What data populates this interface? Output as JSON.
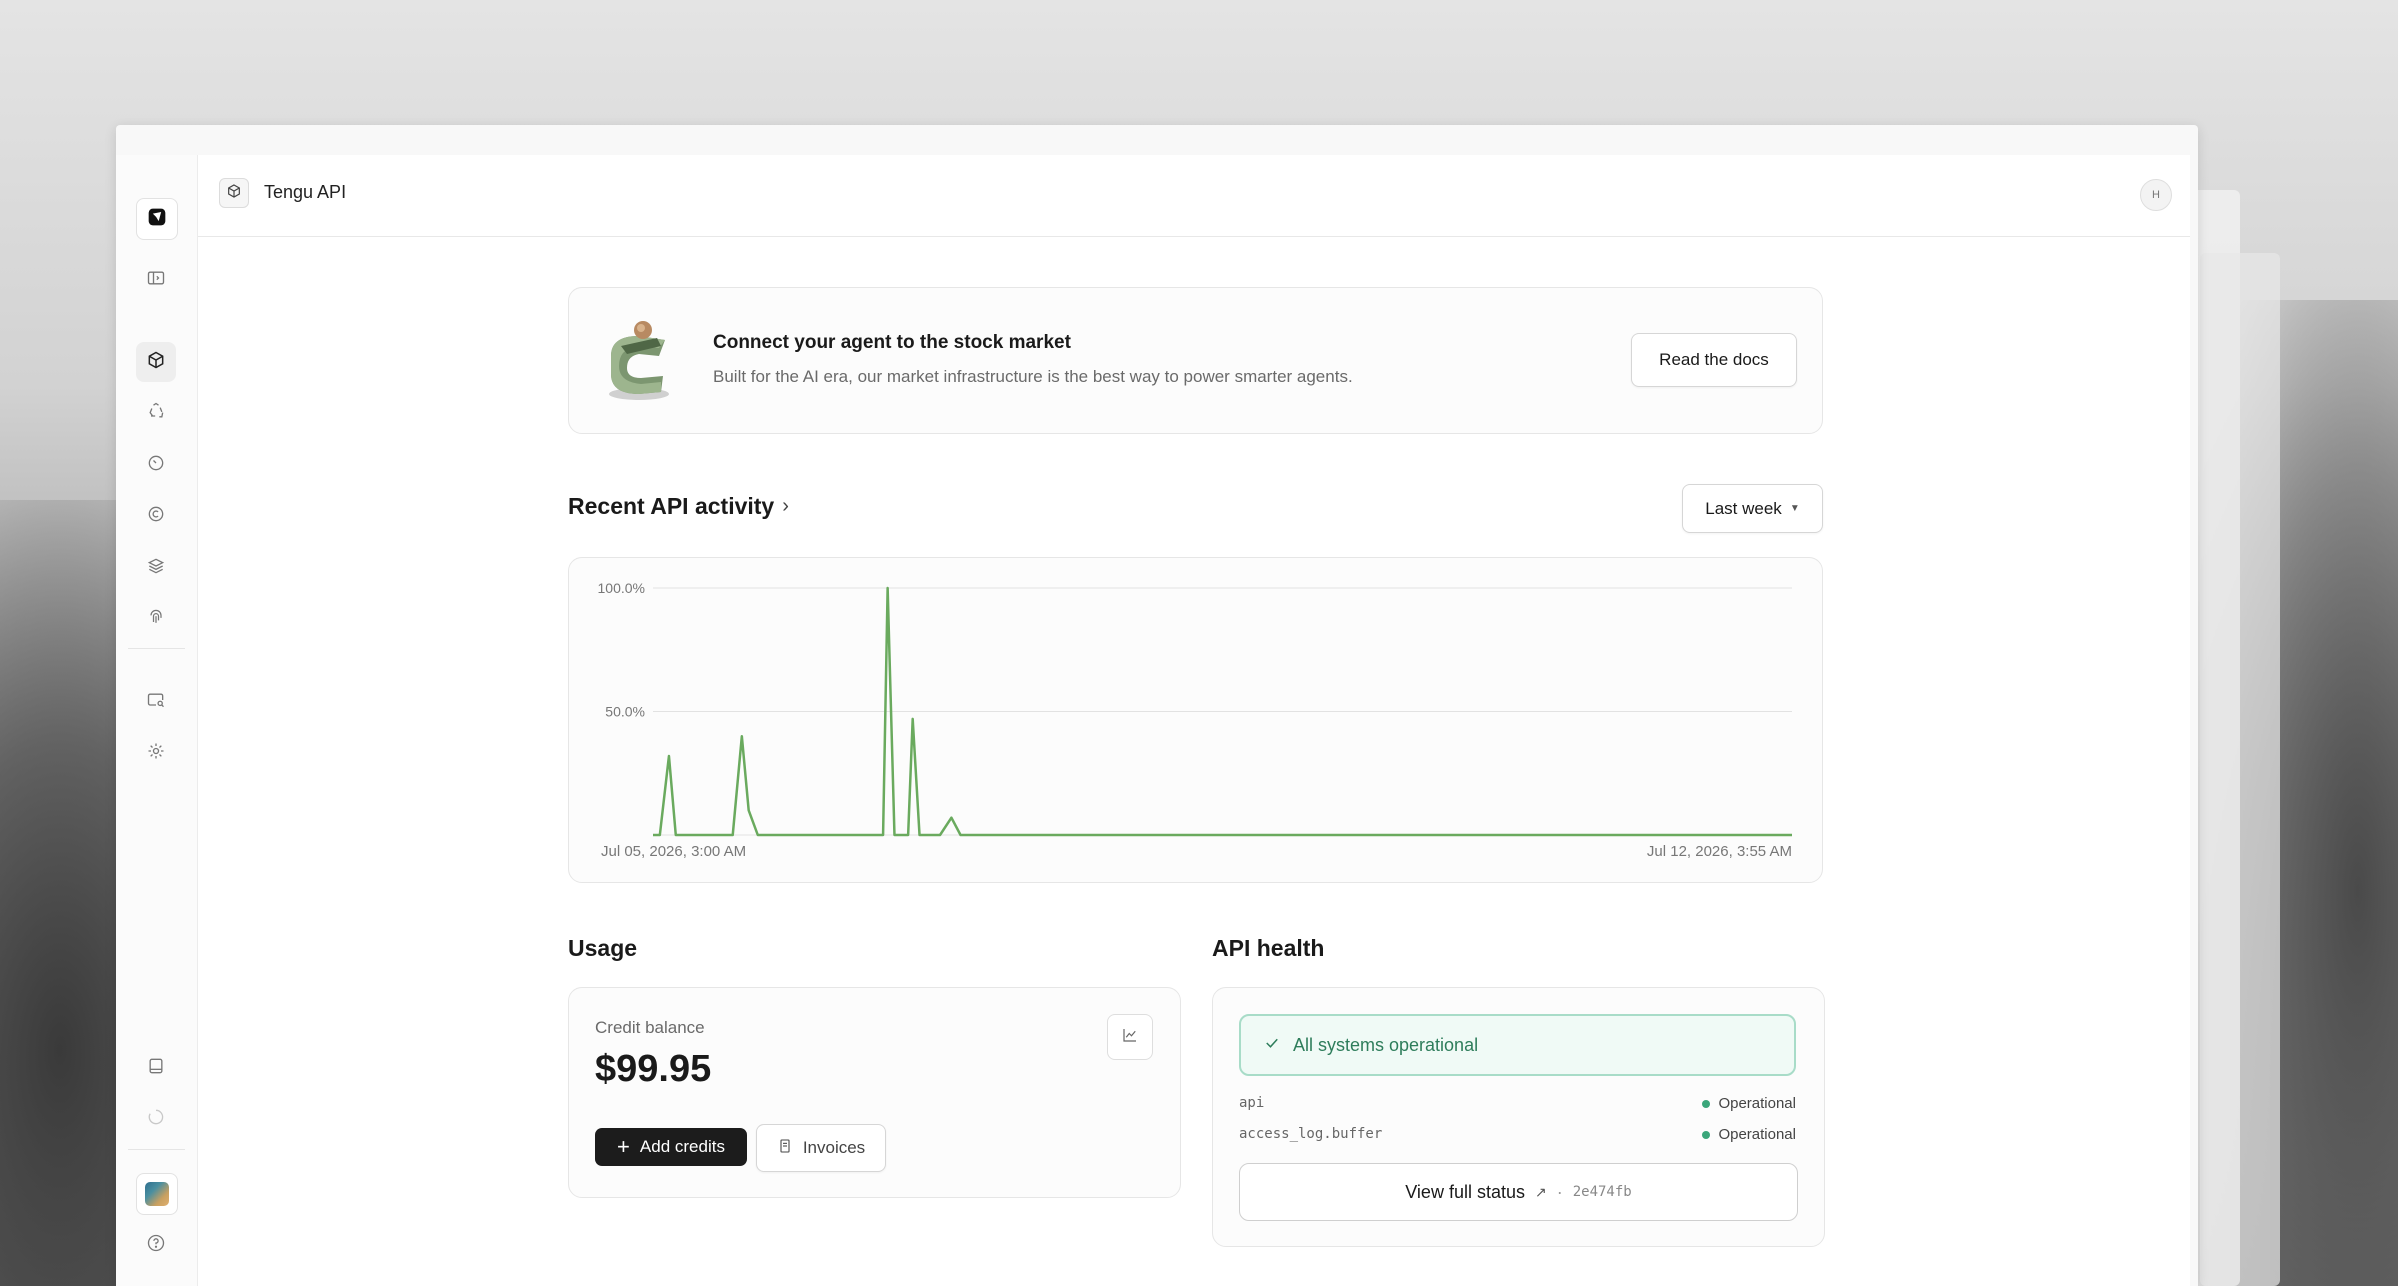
{
  "app": {
    "project_name": "Tengu API",
    "user_initial": "H"
  },
  "sidebar": {
    "items": [
      {
        "name": "logo",
        "icon": "brand-logo-icon"
      },
      {
        "name": "toggle-sidebar",
        "icon": "sidebar-toggle-icon"
      },
      {
        "name": "projects",
        "icon": "cube-icon",
        "active": true
      },
      {
        "name": "integrations",
        "icon": "recycle-icon"
      },
      {
        "name": "usage",
        "icon": "gauge-icon"
      },
      {
        "name": "billing",
        "icon": "coin-icon"
      },
      {
        "name": "layers",
        "icon": "layers-icon"
      },
      {
        "name": "security",
        "icon": "fingerprint-icon"
      },
      {
        "name": "search-logs",
        "icon": "search-window-icon"
      },
      {
        "name": "settings",
        "icon": "gear-icon"
      },
      {
        "name": "docs",
        "icon": "book-icon"
      },
      {
        "name": "status",
        "icon": "loading-icon"
      },
      {
        "name": "account",
        "icon": "avatar-icon"
      },
      {
        "name": "help",
        "icon": "help-icon"
      }
    ]
  },
  "promo": {
    "title": "Connect your agent to the stock market",
    "subtitle": "Built for the AI era, our market infrastructure is the best way to power smarter agents.",
    "button_label": "Read the docs"
  },
  "activity": {
    "title": "Recent API activity",
    "range_label": "Last week"
  },
  "chart_data": {
    "type": "line",
    "title": "",
    "xlabel": "",
    "ylabel": "",
    "ylim": [
      0,
      100
    ],
    "y_ticks": [
      "100.0%",
      "50.0%"
    ],
    "y_tick_values": [
      100,
      50
    ],
    "x_start_label": "Jul 05, 2026, 3:00 AM",
    "x_end_label": "Jul 12, 2026, 3:55 AM",
    "grid": true,
    "color": "#6aaa5e",
    "x": [
      0,
      0.6,
      1.4,
      2.0,
      7.0,
      7.8,
      8.4,
      9.2,
      20.2,
      20.6,
      21.2,
      22.4,
      22.8,
      23.4,
      24.6,
      25.2,
      26.2,
      27.0,
      27.8,
      100
    ],
    "values": [
      0,
      0,
      32,
      0,
      0,
      40,
      10,
      0,
      0,
      100,
      0,
      0,
      47,
      0,
      0,
      0,
      7,
      0,
      0,
      0
    ]
  },
  "usage": {
    "title": "Usage",
    "credit_label": "Credit balance",
    "credit_value": "$99.95",
    "add_credits_label": "Add credits",
    "invoices_label": "Invoices"
  },
  "health": {
    "title": "API health",
    "banner": "All systems operational",
    "services": [
      {
        "name": "api",
        "status": "Operational"
      },
      {
        "name": "access_log.buffer",
        "status": "Operational"
      }
    ],
    "view_status_label": "View full status",
    "separator": "·",
    "commit_hash": "2e474fb",
    "status_color": "#3aa67a"
  }
}
